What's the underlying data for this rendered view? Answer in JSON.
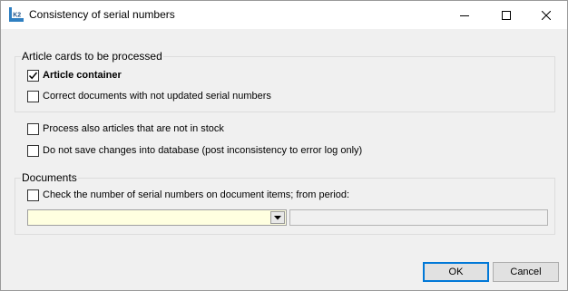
{
  "window": {
    "title": "Consistency of serial numbers",
    "app_icon": "k2-app-icon",
    "controls": [
      "minimize-icon",
      "maximize-icon",
      "close-icon"
    ]
  },
  "groups": {
    "article_cards": {
      "title": "Article cards to be processed",
      "items": [
        {
          "label": "Article container",
          "checked": true,
          "bold": true
        },
        {
          "label": "Correct documents with not updated serial numbers",
          "checked": false
        }
      ]
    },
    "standalone": [
      {
        "label": "Process also articles that are not in stock",
        "checked": false
      },
      {
        "label": "Do not save changes into database (post inconsistency to error log only)",
        "checked": false
      }
    ],
    "documents": {
      "title": "Documents",
      "check_label": "Check the number of serial numbers on document items; from period:",
      "checked": false,
      "period_combo_value": "",
      "period_text_value": ""
    }
  },
  "buttons": {
    "ok": "OK",
    "cancel": "Cancel"
  },
  "colors": {
    "combo_background": "#ffffe0",
    "default_button_border": "#0078d7",
    "window_background": "#f0f0f0"
  }
}
